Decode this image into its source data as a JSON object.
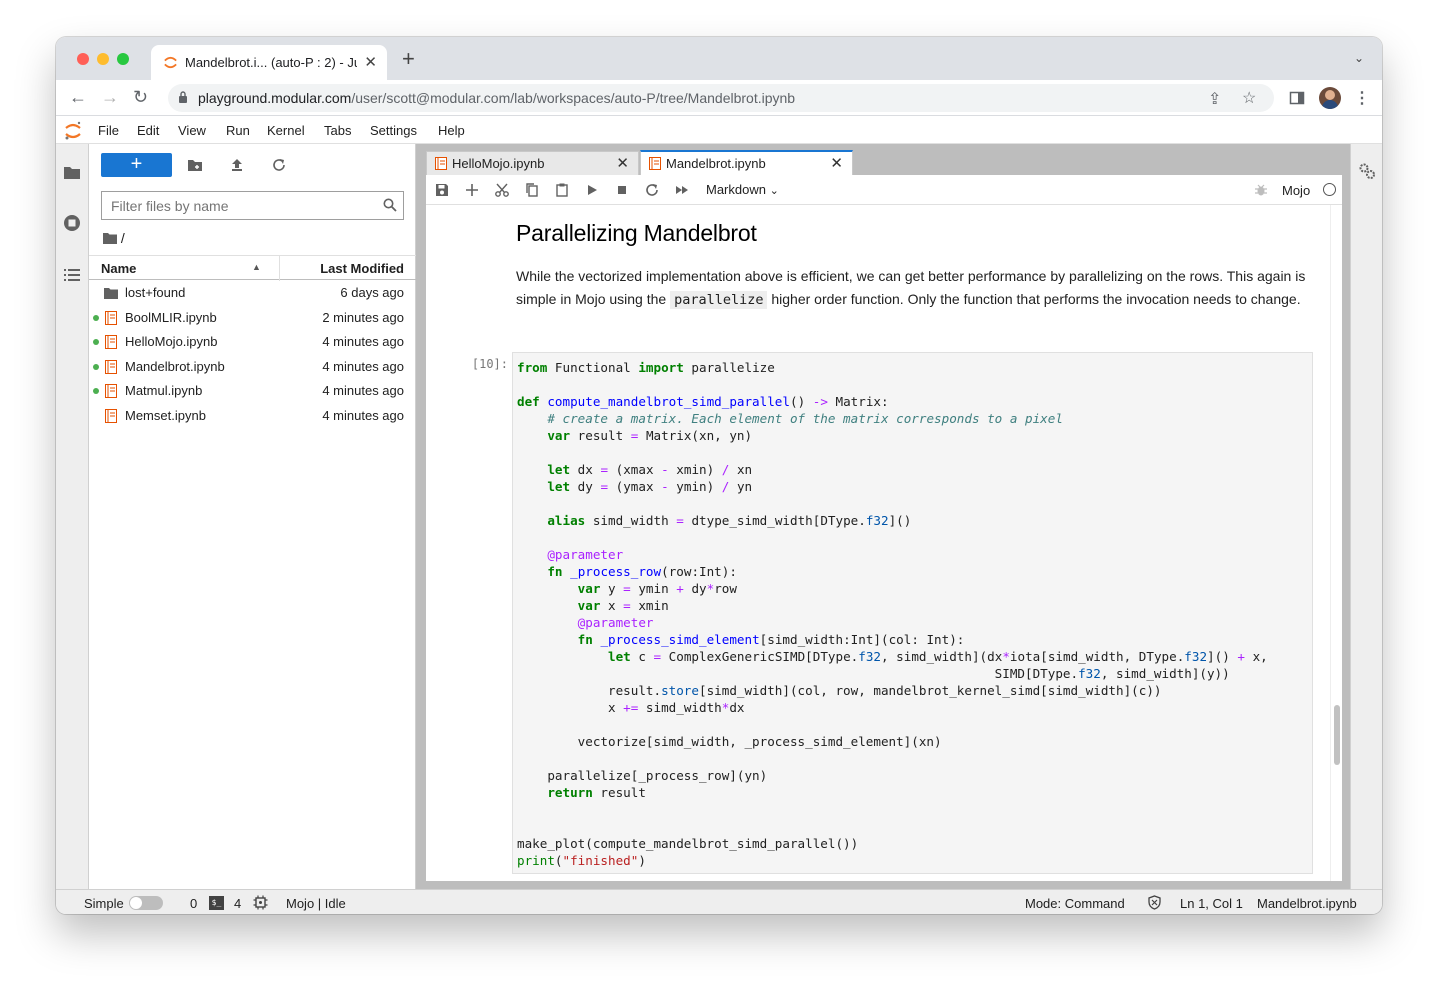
{
  "browser": {
    "tab_title": "Mandelbrot.i... (auto-P : 2) - Ju",
    "url_host": "playground.modular.com",
    "url_path": "/user/scott@modular.com/lab/workspaces/auto-P/tree/Mandelbrot.ipynb"
  },
  "menu": [
    "File",
    "Edit",
    "View",
    "Run",
    "Kernel",
    "Tabs",
    "Settings",
    "Help"
  ],
  "filebrowser": {
    "new_label": "+",
    "filter_placeholder": "Filter files by name",
    "breadcrumb": "/",
    "col_name": "Name",
    "col_modified": "Last Modified",
    "files": [
      {
        "name": "lost+found",
        "modified": "6 days ago",
        "type": "folder",
        "running": false
      },
      {
        "name": "BoolMLIR.ipynb",
        "modified": "2 minutes ago",
        "type": "notebook",
        "running": true
      },
      {
        "name": "HelloMojo.ipynb",
        "modified": "4 minutes ago",
        "type": "notebook",
        "running": true
      },
      {
        "name": "Mandelbrot.ipynb",
        "modified": "4 minutes ago",
        "type": "notebook",
        "running": true
      },
      {
        "name": "Matmul.ipynb",
        "modified": "4 minutes ago",
        "type": "notebook",
        "running": true
      },
      {
        "name": "Memset.ipynb",
        "modified": "4 minutes ago",
        "type": "notebook",
        "running": false
      }
    ]
  },
  "doc_tabs": [
    {
      "label": "HelloMojo.ipynb",
      "active": false
    },
    {
      "label": "Mandelbrot.ipynb",
      "active": true
    }
  ],
  "notebook": {
    "cell_type": "Markdown",
    "kernel_name": "Mojo",
    "heading": "Parallelizing Mandelbrot",
    "para_1": "While the vectorized implementation above is efficient, we can get better performance by parallelizing on the rows. This again is simple in Mojo using the",
    "para_code": "parallelize",
    "para_2": "higher order function. Only the function that performs the invocation needs to change.",
    "prompt": "[10]:"
  },
  "status": {
    "mode_label": "Simple",
    "terminals": "0",
    "kernels": "4",
    "kernel_status": "Mojo | Idle",
    "mode": "Mode: Command",
    "cursor": "Ln 1, Col 1",
    "file": "Mandelbrot.ipynb"
  },
  "colors": {
    "accent": "#1976d2",
    "running": "#4caf50",
    "jupyter_orange": "#f37726"
  }
}
